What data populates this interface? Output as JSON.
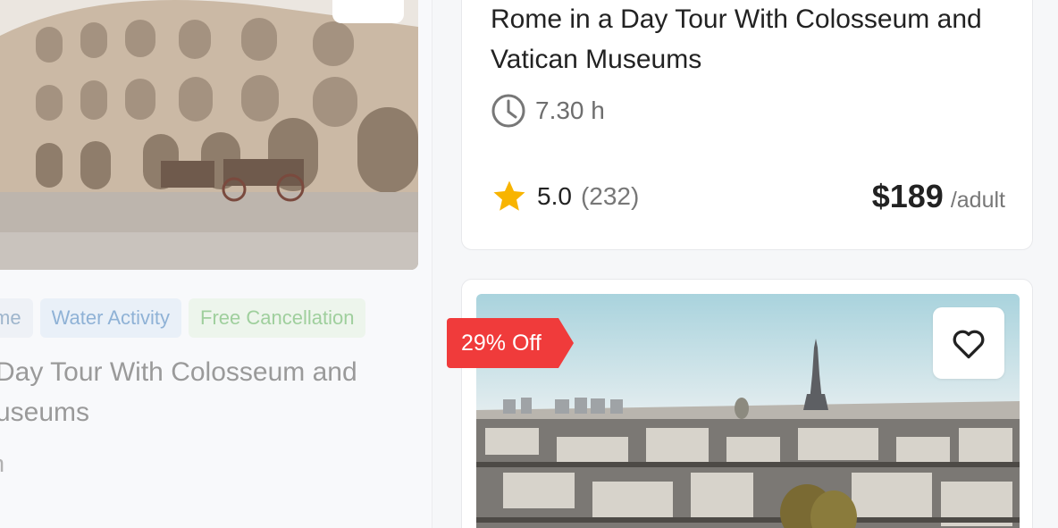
{
  "left_card": {
    "tags": [
      "me",
      "Water Activity",
      "Free Cancellation"
    ],
    "title": "a Day Tour With Colosseum and Museums",
    "duration": "h"
  },
  "top_card": {
    "title": "Rome in a Day Tour With Colosseum and Vatican Museums",
    "duration": "7.30 h",
    "rating": "5.0",
    "reviews": "(232)",
    "price": "$189",
    "price_unit": "/adult"
  },
  "bottom_card": {
    "discount": "29% Off"
  },
  "icons": {
    "clock": "clock-icon",
    "star": "star-icon",
    "heart": "heart-icon"
  },
  "colors": {
    "accent_red": "#f03b3b",
    "star": "#f8b400"
  }
}
